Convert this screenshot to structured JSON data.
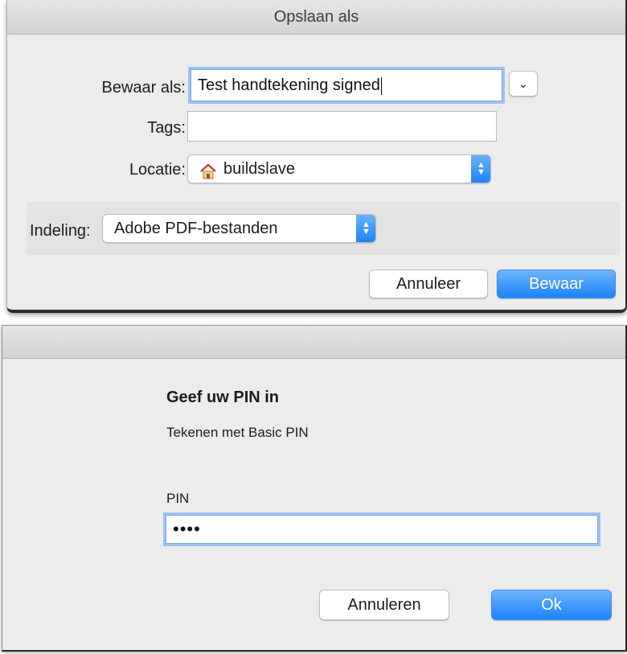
{
  "save_dialog": {
    "title": "Opslaan als",
    "save_as_label": "Bewaar als:",
    "save_as_value": "Test handtekening signed",
    "tags_label": "Tags:",
    "tags_value": "",
    "location_label": "Locatie:",
    "location_value": "buildslave",
    "location_icon": "home-folder-icon",
    "format_label": "Indeling:",
    "format_value": "Adobe PDF-bestanden",
    "cancel_label": "Annuleer",
    "save_label": "Bewaar",
    "accent_color": "#1b83fb"
  },
  "pin_dialog": {
    "heading": "Geef uw PIN in",
    "subtitle": "Tekenen met Basic PIN",
    "pin_label": "PIN",
    "pin_value": "••••",
    "cancel_label": "Annuleren",
    "ok_label": "Ok"
  }
}
